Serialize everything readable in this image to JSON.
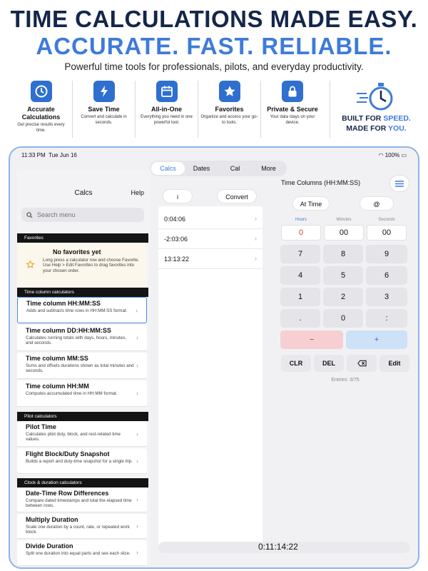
{
  "promo": {
    "headline1": "TIME CALCULATIONS MADE EASY.",
    "headline2": "ACCURATE. FAST. RELIABLE.",
    "tagline": "Powerful time tools for professionals, pilots, and everyday productivity.",
    "features": [
      {
        "icon": "clock-icon",
        "title": "Accurate Calculations",
        "desc": "Get precise results every time."
      },
      {
        "icon": "lightning-icon",
        "title": "Save Time",
        "desc": "Convert and calculate in seconds."
      },
      {
        "icon": "calendar-icon",
        "title": "All-in-One",
        "desc": "Everything you need in one powerful tool."
      },
      {
        "icon": "star-icon",
        "title": "Favorites",
        "desc": "Organize and access your go-to tools."
      },
      {
        "icon": "lock-icon",
        "title": "Private & Secure",
        "desc": "Your data stays on your device."
      }
    ],
    "speed_line1_a": "BUILT FOR ",
    "speed_line1_b": "SPEED.",
    "speed_line2_a": "MADE FOR ",
    "speed_line2_b": "YOU."
  },
  "status": {
    "time": "11:33 PM",
    "date": "Tue Jun 16",
    "battery": "100%"
  },
  "sidebar": {
    "title": "Calcs",
    "help": "Help",
    "search_placeholder": "Search menu",
    "sections": {
      "favorites": "Favorites",
      "time_column": "Time column calculators",
      "pilot": "Pilot calculators",
      "clock": "Clock & duration calculators"
    },
    "fav_empty_title": "No favorites yet",
    "fav_empty_desc": "Long press a calculator row and choose Favorite. Use Help > Edit Favorites to drag favorites into your chosen order.",
    "items": [
      {
        "title": "Time column HH:MM:SS",
        "desc": "Adds and subtracts time rows in HH:MM:SS format."
      },
      {
        "title": "Time column DD:HH:MM:SS",
        "desc": "Calculates running totals with days, hours, minutes, and seconds."
      },
      {
        "title": "Time column MM:SS",
        "desc": "Sums and offsets durations shown as total minutes and seconds."
      },
      {
        "title": "Time column HH:MM",
        "desc": "Computes accumulated time in HH:MM format."
      },
      {
        "title": "Pilot Time",
        "desc": "Calculates pilot duty, block, and rest-related time values."
      },
      {
        "title": "Flight Block/Duty Snapshot",
        "desc": "Builds a report and duty-time snapshot for a single trip."
      },
      {
        "title": "Date-Time Row Differences",
        "desc": "Compare dated timestamps and total the elapsed time between rows."
      },
      {
        "title": "Multiply Duration",
        "desc": "Scale one duration by a count, rate, or repeated work block."
      },
      {
        "title": "Divide Duration",
        "desc": "Split one duration into equal parts and see each slice."
      }
    ]
  },
  "tabs": [
    "Calcs",
    "Dates",
    "Cal",
    "More"
  ],
  "middle": {
    "info_label": "i",
    "convert_label": "Convert",
    "rows": [
      "0:04:06",
      "-2:03:06",
      "13:13:22"
    ],
    "total": "0:11:14:22"
  },
  "right": {
    "title": "Time Columns (HH:MM:SS)",
    "at_time": "At Time",
    "at_symbol": "@",
    "labels": [
      "Hours",
      "Minutes",
      "Seconds"
    ],
    "fields": [
      "0",
      "00",
      "00"
    ],
    "keys": [
      "7",
      "8",
      "9",
      "4",
      "5",
      "6",
      "1",
      "2",
      "3",
      ".",
      "0",
      ":"
    ],
    "minus": "−",
    "plus": "+",
    "clr": "CLR",
    "del": "DEL",
    "edit": "Edit",
    "entries": "Entries: 3/75"
  },
  "colors": {
    "accent": "#3e7bd9",
    "navy": "#14264a",
    "minus_bg": "#f6cfd2",
    "plus_bg": "#cde1f7"
  }
}
